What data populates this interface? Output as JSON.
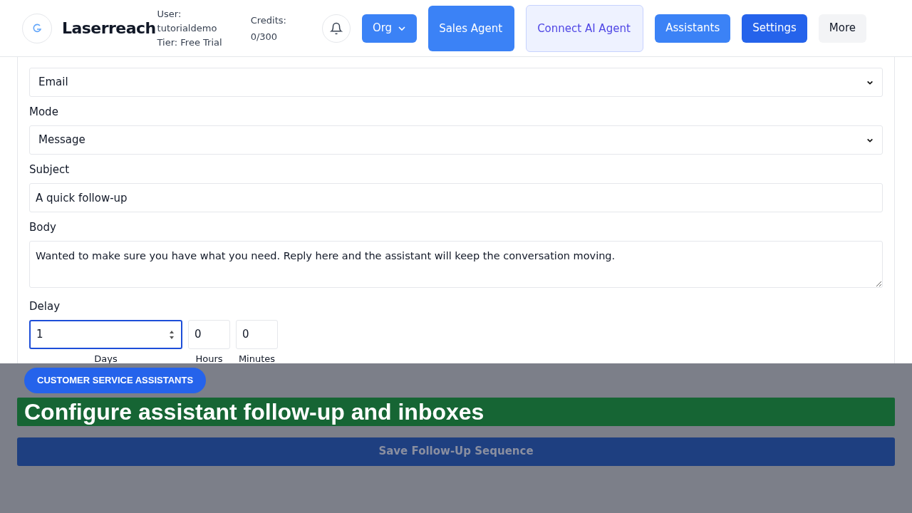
{
  "header": {
    "brand": "Laserreach",
    "user_lines": [
      "User:",
      "tutorialdemo",
      "Tier: Free Trial"
    ],
    "credits_lines": [
      "Credits:",
      "0/300"
    ],
    "nav": [
      {
        "label": "Org",
        "kind": "dropdown"
      },
      {
        "label": "Sales Agent",
        "kind": "primary"
      },
      {
        "label": "Connect AI Agent",
        "kind": "soft"
      },
      {
        "label": "Assistants",
        "kind": "primary"
      },
      {
        "label": "Settings",
        "kind": "dark"
      },
      {
        "label": "More",
        "kind": "plain"
      }
    ]
  },
  "form": {
    "channel": {
      "value": "Email"
    },
    "mode": {
      "label": "Mode",
      "value": "Message"
    },
    "subject": {
      "label": "Subject",
      "value": "A quick follow-up"
    },
    "body": {
      "label": "Body",
      "value": "Wanted to make sure you have what you need. Reply here and the assistant will keep the conversation moving."
    },
    "delay": {
      "label": "Delay",
      "fields": [
        {
          "label": "Days",
          "value": "1",
          "focused": true
        },
        {
          "label": "Hours",
          "value": "0",
          "focused": false
        },
        {
          "label": "Minutes",
          "value": "0",
          "focused": false
        }
      ]
    }
  },
  "overlay": {
    "badge": "CUSTOMER SERVICE ASSISTANTS",
    "caption": "Configure assistant follow-up and inboxes",
    "save_button": "Save Follow-Up Sequence"
  }
}
